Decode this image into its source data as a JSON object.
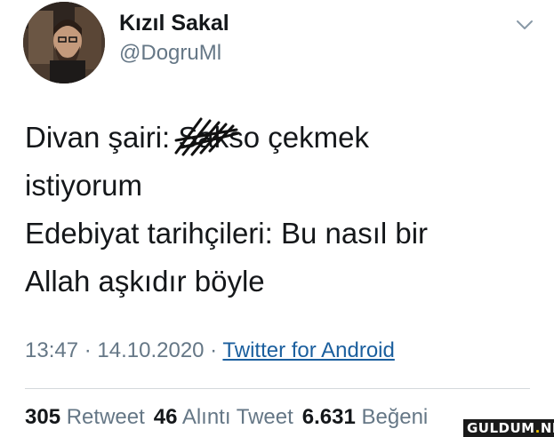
{
  "user": {
    "display_name": "Kızıl Sakal",
    "handle": "@DogruMl",
    "avatar_icon": "user-avatar-photo"
  },
  "menu_icon": "chevron-down-icon",
  "tweet": {
    "lines": [
      {
        "before": "Divan şairi: ",
        "censored": "Sakso",
        "after": " çekmek"
      },
      {
        "text": "istiyorum"
      },
      {
        "text": "Edebiyat tarihçileri: Bu nasıl bir"
      },
      {
        "text": "Allah aşkıdır böyle"
      }
    ]
  },
  "meta": {
    "time": "13:47",
    "separator": " · ",
    "date": "14.10.2020",
    "source": "Twitter for Android"
  },
  "stats": {
    "retweets_count": "305",
    "retweets_label": "Retweet",
    "quotes_count": "46",
    "quotes_label": "Alıntı Tweet",
    "likes_count": "6.631",
    "likes_label": "Beğeni"
  },
  "watermark": {
    "text": "GULDUM",
    "dot": ".",
    "tld": "NET"
  },
  "colors": {
    "text": "#14171a",
    "secondary": "#657786",
    "link": "#1b5f9e",
    "divider": "#d4d8dc"
  }
}
